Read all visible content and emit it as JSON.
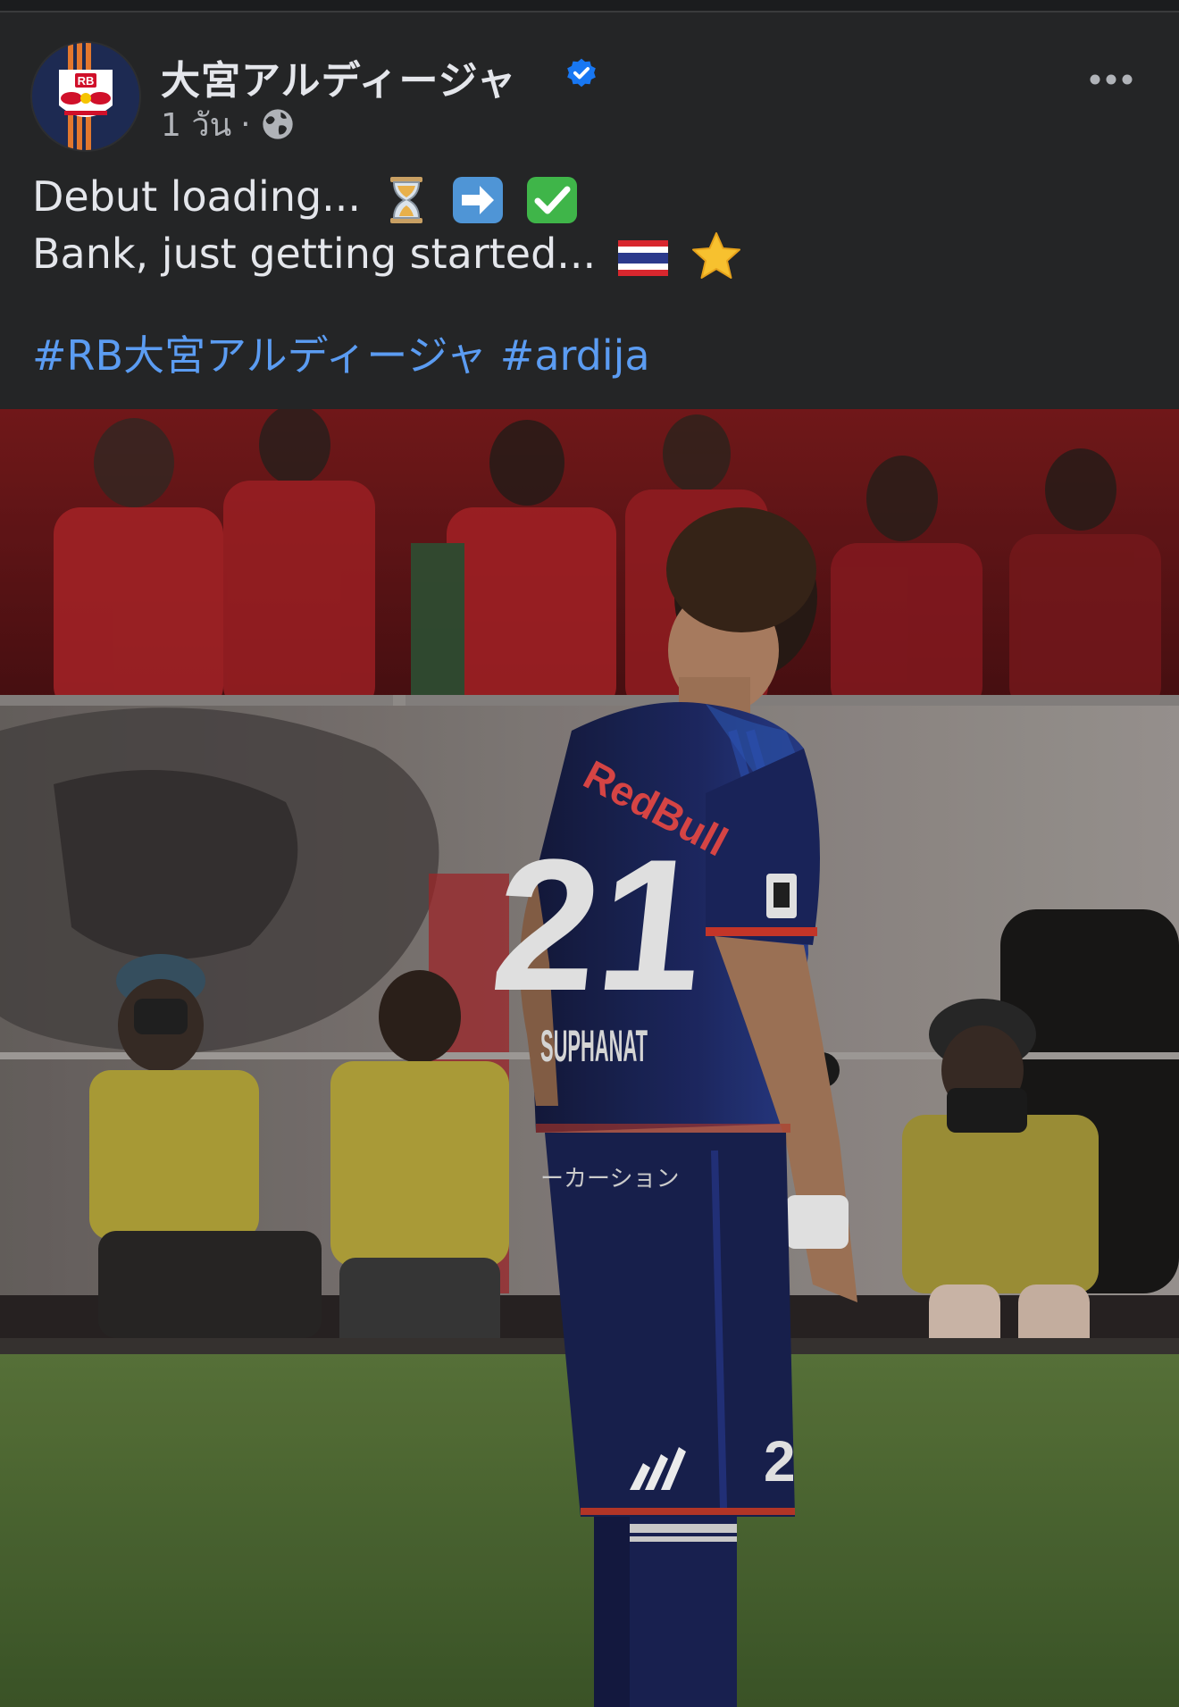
{
  "post": {
    "page_name": "大宮アルディージャ",
    "verified_icon": "verified-badge-icon",
    "timestamp": "1 วัน",
    "separator": "·",
    "audience_icon": "globe-icon",
    "more_icon": "more-dots-icon",
    "text_line_1": "Debut loading...",
    "text_line_1_emojis": [
      "hourglass-emoji",
      "arrow-right-emoji",
      "check-mark-emoji"
    ],
    "text_line_2": "Bank, just getting started...",
    "text_line_2_emojis": [
      "thailand-flag-emoji",
      "star-emoji"
    ],
    "hashtags": [
      "#RB大宮アルディージャ",
      "#ardija"
    ],
    "avatar_logo_text": "RB",
    "photo": {
      "jersey_sponsor": "RedBull",
      "jersey_number": "21",
      "jersey_name": "SUPHANAT",
      "jersey_sponsor_jp": "ーカーション",
      "shorts_number": "2"
    }
  },
  "colors": {
    "background": "#242526",
    "text": "#e4e6eb",
    "muted": "#b0b3b8",
    "hashtag": "#5b9cf2",
    "verified": "#1877f2"
  }
}
